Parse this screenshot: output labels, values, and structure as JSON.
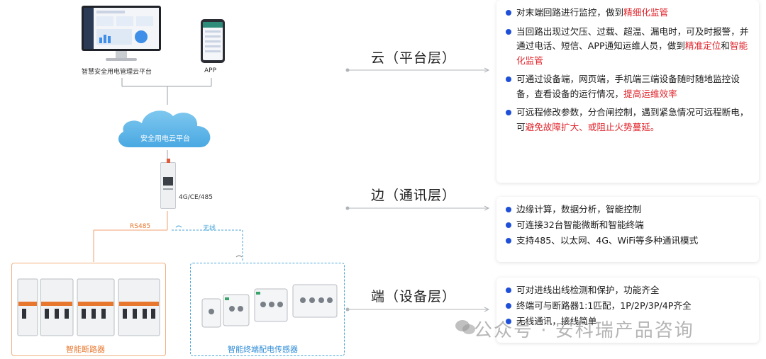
{
  "left": {
    "platform_label": "智慧安全用电管理云平台",
    "app_label": "APP",
    "cloud_label": "安全用电云平台",
    "gateway_label": "4G/CE/485",
    "rs485_label": "RS485",
    "wireless_label": "无线",
    "breaker_label": "智能断路器",
    "sensor_label": "智能终端配电传感器"
  },
  "layers": {
    "cloud": "云（平台层）",
    "edge": "边（通讯层）",
    "terminal": "端（设备层）"
  },
  "panels": {
    "cloud": {
      "i1_a": "对末端回路进行监控，做到",
      "i1_b": "精细化监管",
      "i2_a": "当回路出现过欠压、过载、超温、漏电时，可及时报警，并通过电话、短信、APP通知运维人员，做到",
      "i2_b": "精准定位",
      "i2_c": "和",
      "i2_d": "智能化监管",
      "i3_a": "可通过设备端，网页端，手机端三端设备随时随地监控设备，查看设备的运行情况，",
      "i3_b": "提高运维效率",
      "i4_a": "可远程修改参数，分合闸控制，遇到紧急情况可远程断电，可",
      "i4_b": "避免故障扩大、或阻止火势蔓延。"
    },
    "edge": {
      "i1": "边缘计算，数据分析，智能控制",
      "i2": "可连接32台智能微断和智能终端",
      "i3": "支持485、以太网、4G、WiFi等多种通讯模式"
    },
    "terminal": {
      "i1": "可对进线出线检测和保护，功能齐全",
      "i2": "终端可与断路器1:1匹配，1P/2P/3P/4P齐全",
      "i3": "无线通讯，接线简单"
    }
  },
  "watermark": "公众号 · 安科瑞产品咨询",
  "colors": {
    "bullet": "#1e4fd8",
    "highlight": "#e0232a",
    "orange": "#e8772e",
    "blue": "#2d8bd6"
  }
}
